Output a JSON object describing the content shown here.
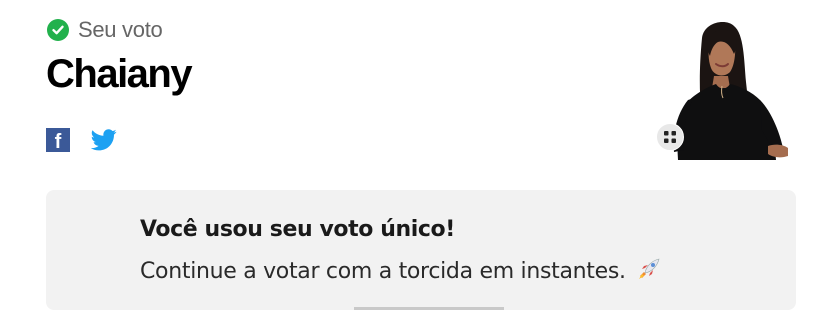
{
  "vote": {
    "label": "Seu voto",
    "icon": "check-circle-icon",
    "icon_color": "#22b14c"
  },
  "participant": {
    "name": "Chaiany"
  },
  "share": {
    "facebook_glyph": "f",
    "facebook_color": "#3b5998",
    "twitter_color": "#1da1f2"
  },
  "notice": {
    "title": "Você usou seu voto único!",
    "text": "Continue a votar com a torcida em instantes.",
    "icon": "rocket-icon"
  }
}
